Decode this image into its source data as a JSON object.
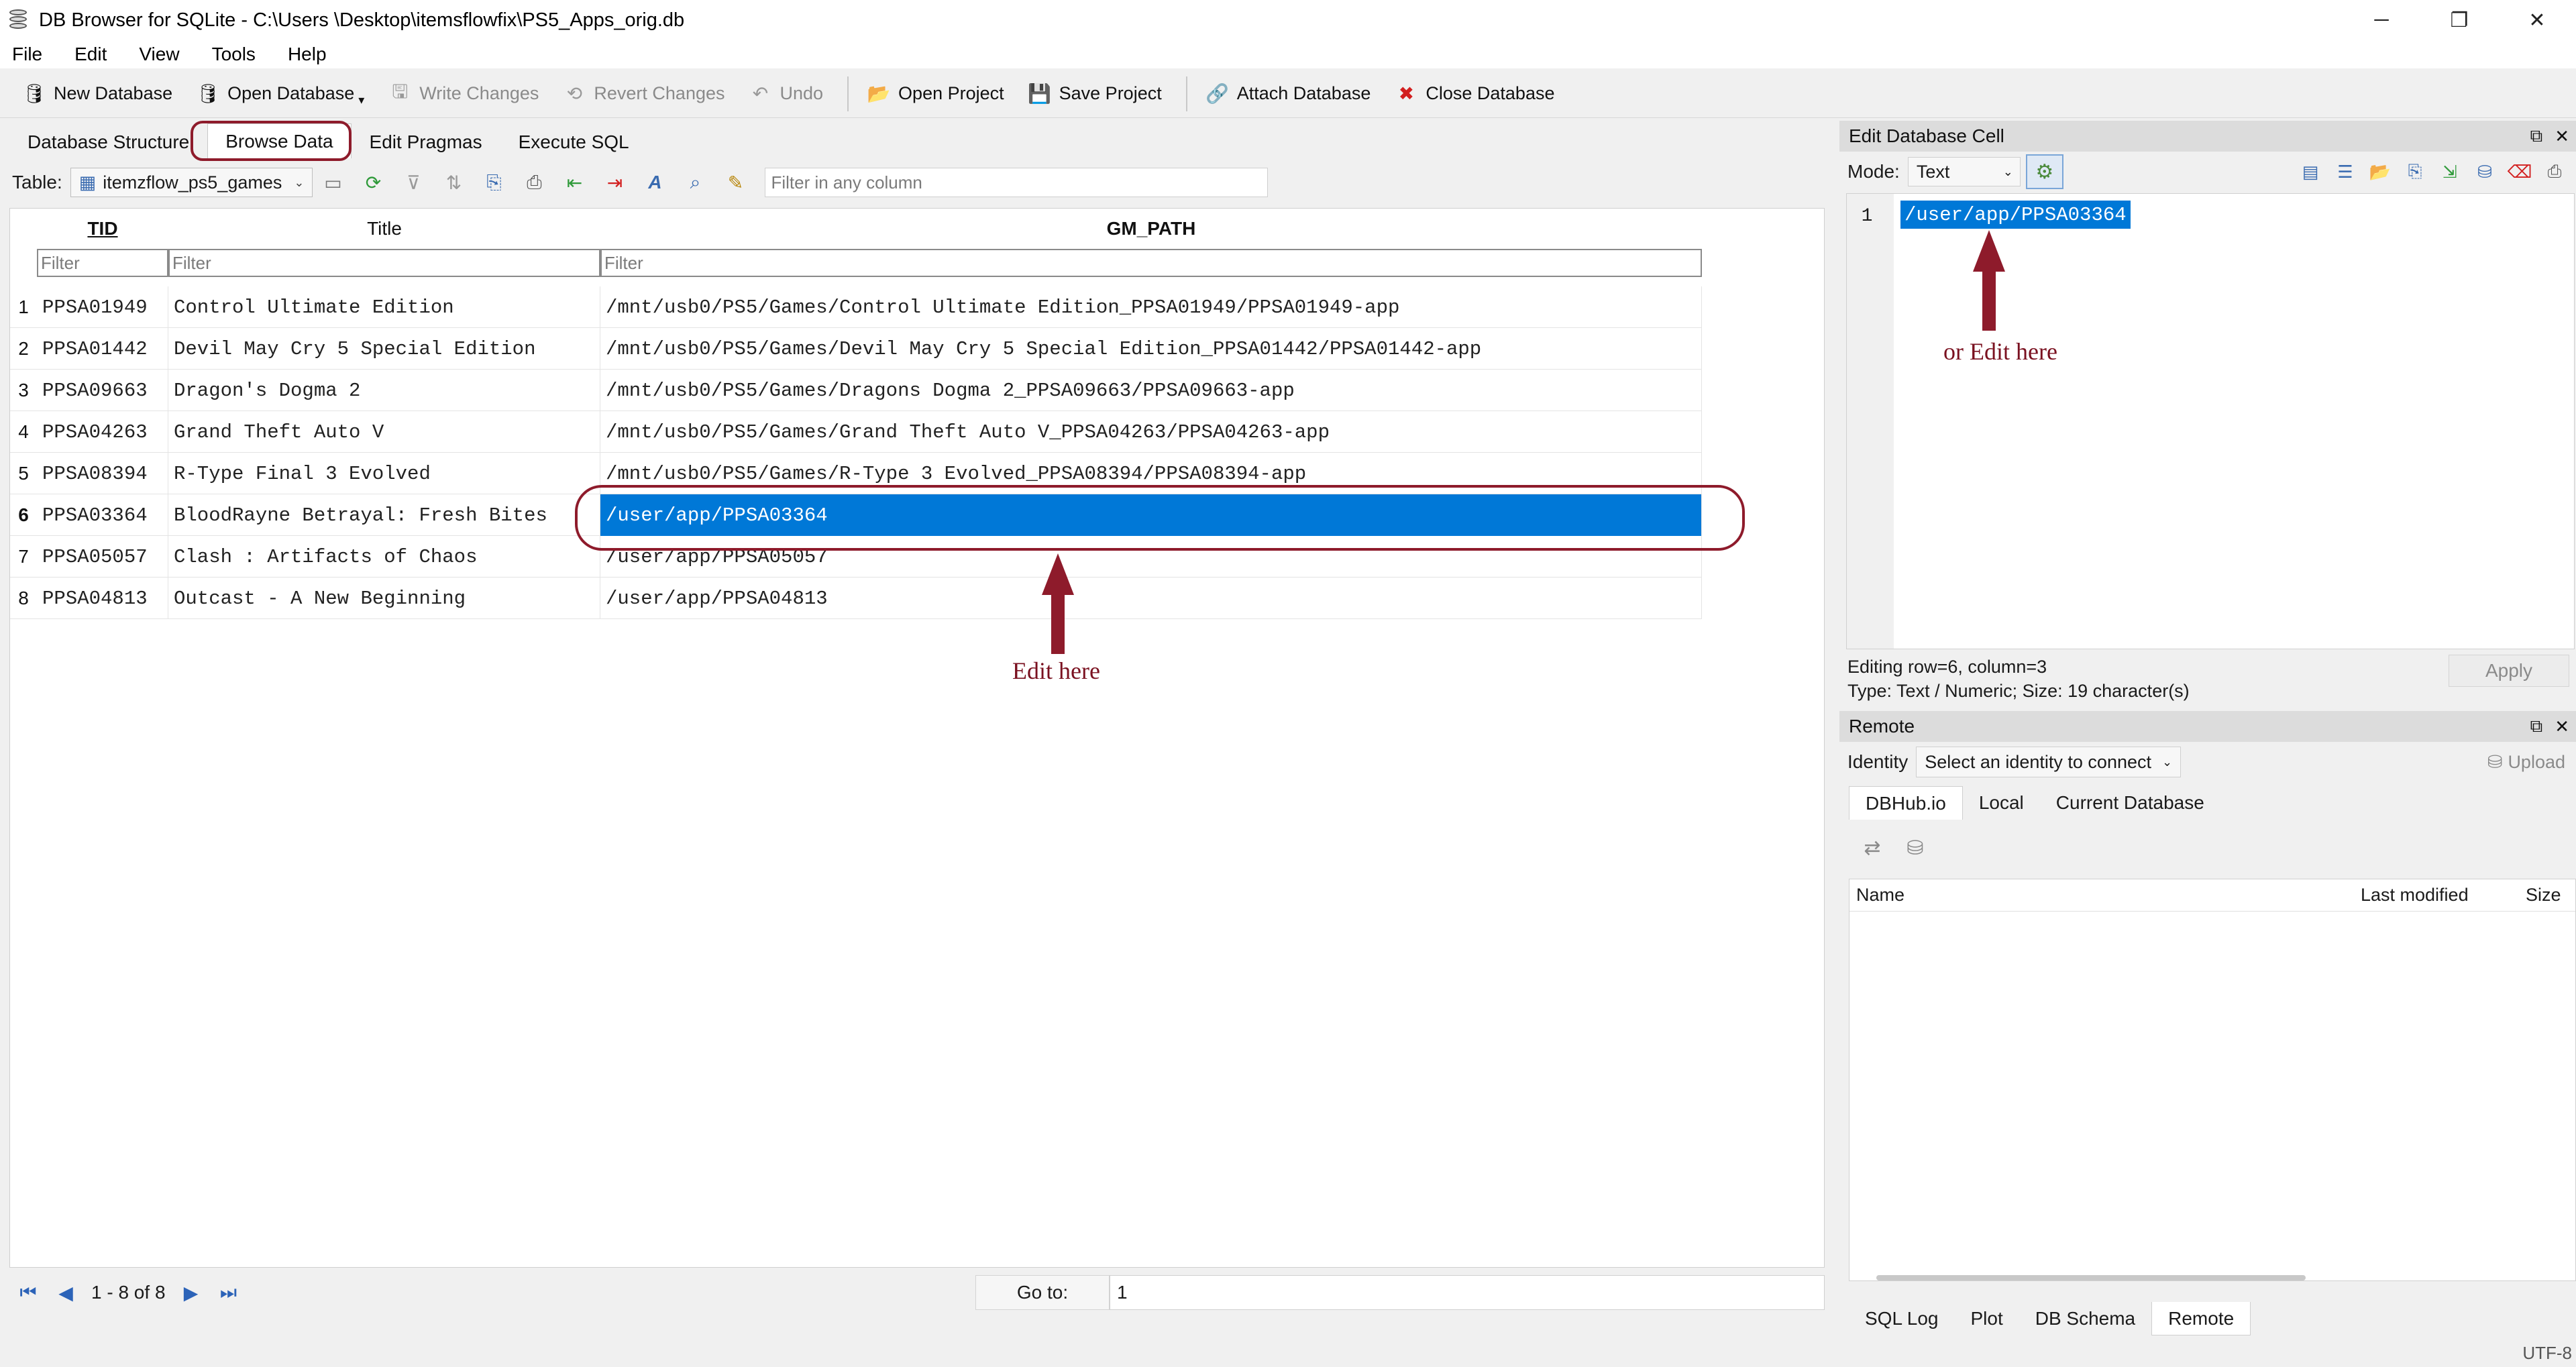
{
  "window": {
    "title": "DB Browser for SQLite - C:\\Users            \\Desktop\\itemsflowfix\\PS5_Apps_orig.db",
    "minimize": "─",
    "restore": "❐",
    "close": "✕"
  },
  "menu": [
    "File",
    "Edit",
    "View",
    "Tools",
    "Help"
  ],
  "toolbar": {
    "new_database": "New Database",
    "open_database": "Open Database",
    "write_changes": "Write Changes",
    "revert_changes": "Revert Changes",
    "undo": "Undo",
    "open_project": "Open Project",
    "save_project": "Save Project",
    "attach_database": "Attach Database",
    "close_database": "Close Database"
  },
  "tabs": [
    "Database Structure",
    "Browse Data",
    "Edit Pragmas",
    "Execute SQL"
  ],
  "browse": {
    "table_label": "Table:",
    "table_name": "itemzflow_ps5_games",
    "filter_all_placeholder": "Filter in any column",
    "columns": [
      "TID",
      "Title",
      "GM_PATH"
    ],
    "filter_placeholder": "Filter",
    "rows": [
      {
        "n": "1",
        "tid": "PPSA01949",
        "title": "Control Ultimate Edition",
        "path": "/mnt/usb0/PS5/Games/Control Ultimate Edition_PPSA01949/PPSA01949-app"
      },
      {
        "n": "2",
        "tid": "PPSA01442",
        "title": "Devil May Cry 5 Special Edition",
        "path": "/mnt/usb0/PS5/Games/Devil May Cry 5 Special Edition_PPSA01442/PPSA01442-app"
      },
      {
        "n": "3",
        "tid": "PPSA09663",
        "title": "Dragon's Dogma 2",
        "path": "/mnt/usb0/PS5/Games/Dragons Dogma 2_PPSA09663/PPSA09663-app"
      },
      {
        "n": "4",
        "tid": "PPSA04263",
        "title": "Grand Theft Auto V",
        "path": "/mnt/usb0/PS5/Games/Grand Theft Auto V_PPSA04263/PPSA04263-app"
      },
      {
        "n": "5",
        "tid": "PPSA08394",
        "title": "R-Type Final 3 Evolved",
        "path": "/mnt/usb0/PS5/Games/R-Type 3 Evolved_PPSA08394/PPSA08394-app"
      },
      {
        "n": "6",
        "tid": "PPSA03364",
        "title": "BloodRayne Betrayal: Fresh Bites",
        "path": "/user/app/PPSA03364"
      },
      {
        "n": "7",
        "tid": "PPSA05057",
        "title": "Clash : Artifacts of Chaos",
        "path": "/user/app/PPSA05057"
      },
      {
        "n": "8",
        "tid": "PPSA04813",
        "title": "Outcast - A New Beginning",
        "path": "/user/app/PPSA04813"
      }
    ],
    "pager_text": "1 - 8 of 8",
    "goto_label": "Go to:",
    "goto_value": "1"
  },
  "annotations": {
    "edit_here": "Edit here",
    "or_edit_here": "or Edit here",
    "color": "#7a1120"
  },
  "edit_cell": {
    "title": "Edit Database Cell",
    "mode_label": "Mode:",
    "mode_value": "Text",
    "line_no": "1",
    "value": "/user/app/PPSA03364",
    "status_line1": "Editing row=6, column=3",
    "status_line2": "Type: Text / Numeric; Size: 19 character(s)",
    "apply": "Apply"
  },
  "remote": {
    "title": "Remote",
    "identity_label": "Identity",
    "identity_value": "Select an identity to connect",
    "upload": "Upload",
    "tabs": [
      "DBHub.io",
      "Local",
      "Current Database"
    ],
    "columns": [
      "Name",
      "Last modified",
      "Size"
    ]
  },
  "bottom_tabs": [
    "SQL Log",
    "Plot",
    "DB Schema",
    "Remote"
  ],
  "status": {
    "encoding": "UTF-8"
  },
  "colors": {
    "selection": "#0078d7",
    "annotation": "#8e1b2b"
  }
}
